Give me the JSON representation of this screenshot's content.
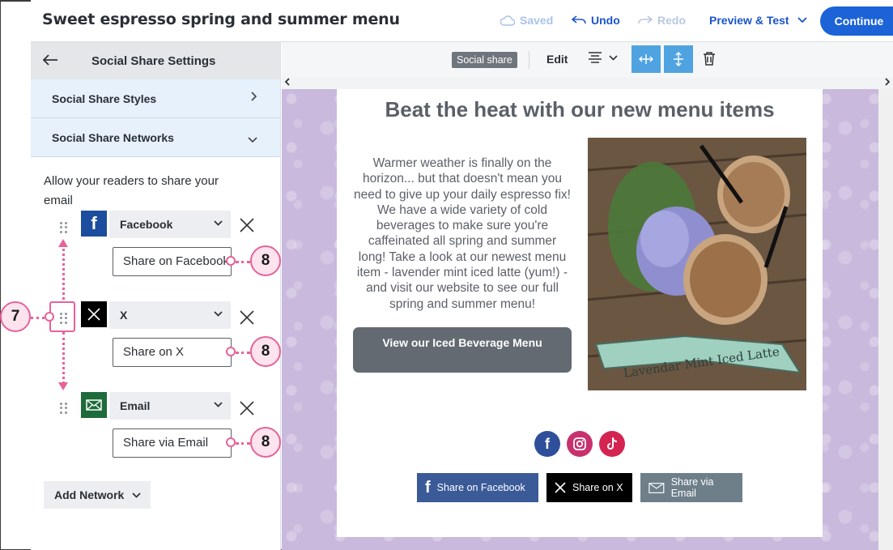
{
  "topbar": {
    "title": "Sweet espresso spring and summer menu",
    "saved": "Saved",
    "undo": "Undo",
    "redo": "Redo",
    "preview": "Preview & Test",
    "continue": "Continue"
  },
  "panel": {
    "title": "Social Share Settings",
    "sections": [
      {
        "label": "Social Share Styles"
      },
      {
        "label": "Social Share Networks"
      }
    ],
    "allow_text": "Allow your readers to share your email",
    "networks": [
      {
        "name": "Facebook",
        "share_text": "Share on Facebook",
        "color": "#1d4d9e"
      },
      {
        "name": "X",
        "share_text": "Share on X",
        "color": "#000000"
      },
      {
        "name": "Email",
        "share_text": "Share via Email",
        "color": "#1e6b3b"
      }
    ],
    "add_network": "Add Network",
    "callouts": {
      "drag": "7",
      "share": "8"
    }
  },
  "toolbar": {
    "tag": "Social share",
    "edit": "Edit"
  },
  "email": {
    "heading": "Beat the heat with our new menu items",
    "body": "Warmer weather is finally on the horizon... but that doesn't mean you need to give up your daily espresso fix! We have a wide variety of cold beverages to make sure you're caffeinated all spring and summer long! Take a look at our newest menu item - lavender mint iced latte (yum!) - and visit our website to see our full spring and summer menu!",
    "cta": "View our Iced Beverage Menu",
    "photo_banner": "Lavendar Mint Iced Latte",
    "share_buttons": [
      {
        "label": "Share on Facebook",
        "color": "#3a5a98"
      },
      {
        "label": "Share on X",
        "color": "#000000"
      },
      {
        "label": "Share via Email",
        "color": "#6e7f8a"
      }
    ],
    "social_icons": [
      {
        "name": "facebook-icon",
        "color": "#2f4f9a"
      },
      {
        "name": "instagram-icon",
        "color": "#c7326e"
      },
      {
        "name": "tiktok-icon",
        "color": "#d42452"
      }
    ]
  }
}
